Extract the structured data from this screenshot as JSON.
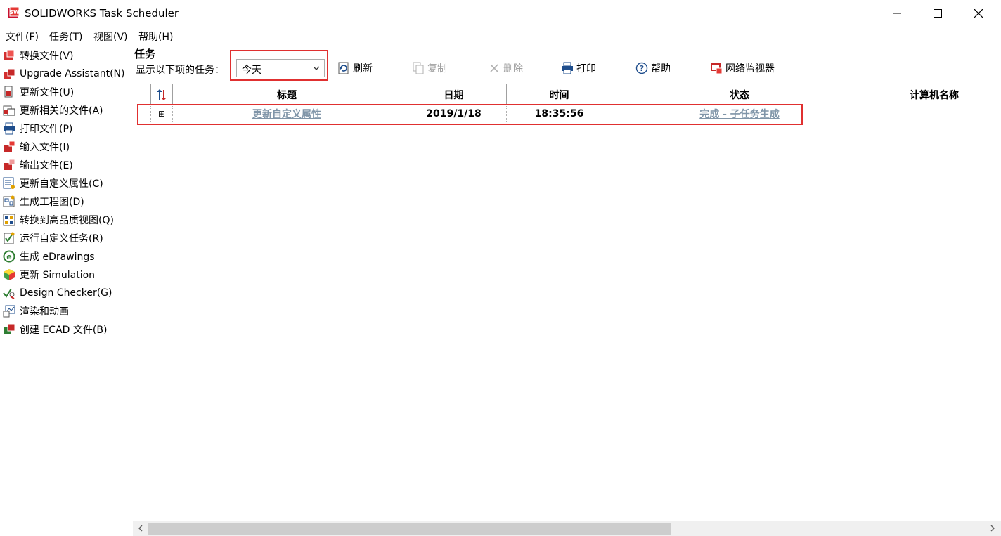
{
  "window": {
    "title": "SOLIDWORKS Task Scheduler",
    "minimize": "minimize",
    "maximize": "maximize",
    "close": "close"
  },
  "menu": [
    "文件(F)",
    "任务(T)",
    "视图(V)",
    "帮助(H)"
  ],
  "sidebar": {
    "items": [
      {
        "label": "转换文件(V)",
        "icon": "convert-files-icon"
      },
      {
        "label": "Upgrade Assistant(N)",
        "icon": "upgrade-assistant-icon"
      },
      {
        "label": "更新文件(U)",
        "icon": "update-files-icon"
      },
      {
        "label": "更新相关的文件(A)",
        "icon": "update-related-files-icon"
      },
      {
        "label": "打印文件(P)",
        "icon": "print-files-icon"
      },
      {
        "label": "输入文件(I)",
        "icon": "import-files-icon"
      },
      {
        "label": "输出文件(E)",
        "icon": "export-files-icon"
      },
      {
        "label": "更新自定义属性(C)",
        "icon": "update-custom-properties-icon"
      },
      {
        "label": "生成工程图(D)",
        "icon": "create-drawings-icon"
      },
      {
        "label": "转换到高品质视图(Q)",
        "icon": "high-quality-views-icon"
      },
      {
        "label": "运行自定义任务(R)",
        "icon": "custom-task-icon"
      },
      {
        "label": "生成 eDrawings",
        "icon": "edrawings-icon"
      },
      {
        "label": "更新 Simulation",
        "icon": "simulation-icon"
      },
      {
        "label": "Design Checker(G)",
        "icon": "design-checker-icon"
      },
      {
        "label": "渲染和动画",
        "icon": "render-animation-icon"
      },
      {
        "label": "创建 ECAD 文件(B)",
        "icon": "ecad-files-icon"
      }
    ]
  },
  "tasks": {
    "heading": "任务",
    "filter_label": "显示以下项的任务：",
    "filter_value": "今天"
  },
  "toolbar": {
    "refresh": "刷新",
    "copy": "复制",
    "delete": "删除",
    "print": "打印",
    "help": "帮助",
    "network_monitor": "网络监视器"
  },
  "table": {
    "columns": [
      "标题",
      "日期",
      "时间",
      "状态",
      "计算机名称"
    ],
    "rows": [
      {
        "expand": "⊞",
        "title": "更新自定义属性",
        "date": "2019/1/18",
        "time": "18:35:56",
        "status": "完成 - 子任务生成",
        "computer": ""
      }
    ]
  },
  "colors": {
    "highlight": "#e03030",
    "link": "#8095a8",
    "disabled": "#a0a0a0"
  }
}
